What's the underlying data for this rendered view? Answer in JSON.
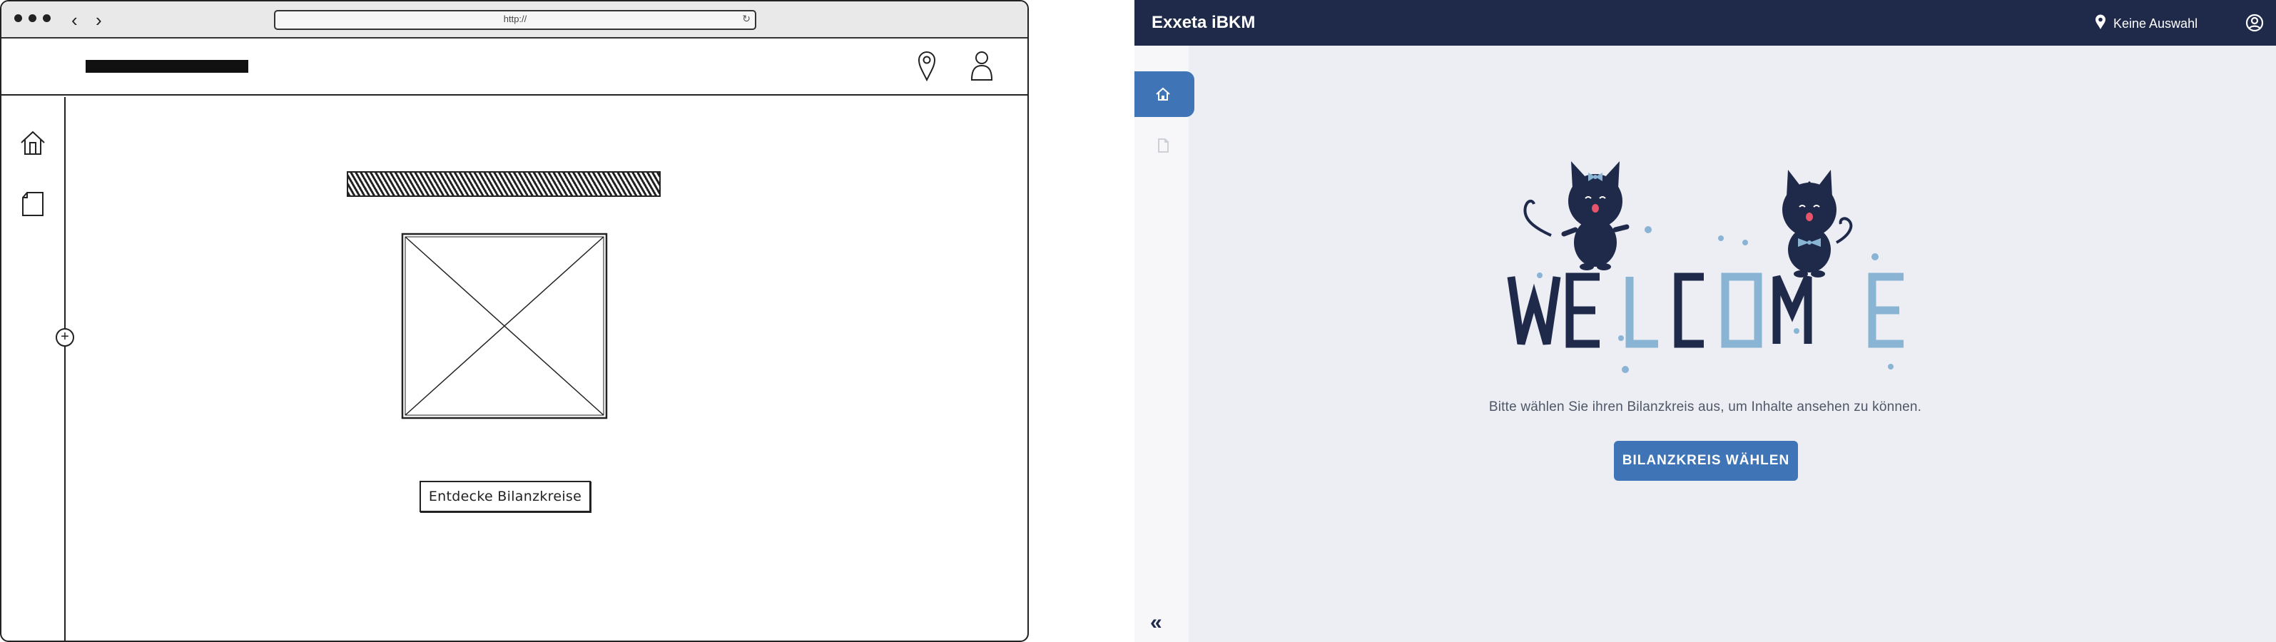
{
  "wireframe": {
    "url": "http://",
    "button_label": "Entdecke Bilanzkreise"
  },
  "app": {
    "title": "Exxeta iBKM",
    "location_label": "Keine Auswahl",
    "sidebar": {
      "items": [
        {
          "icon": "home-icon",
          "active": true
        },
        {
          "icon": "document-icon",
          "active": false
        }
      ],
      "collapse_label": "«"
    },
    "welcome": {
      "word": "WELCOME",
      "message": "Bitte wählen Sie ihren Bilanzkreis aus, um Inhalte ansehen zu können.",
      "button_label": "BILANZKREIS WÄHLEN"
    }
  },
  "colors": {
    "header_bg": "#1f2a4a",
    "accent": "#3f74b6",
    "light_blue": "#8ab4d4",
    "content_bg": "#eceef4"
  }
}
